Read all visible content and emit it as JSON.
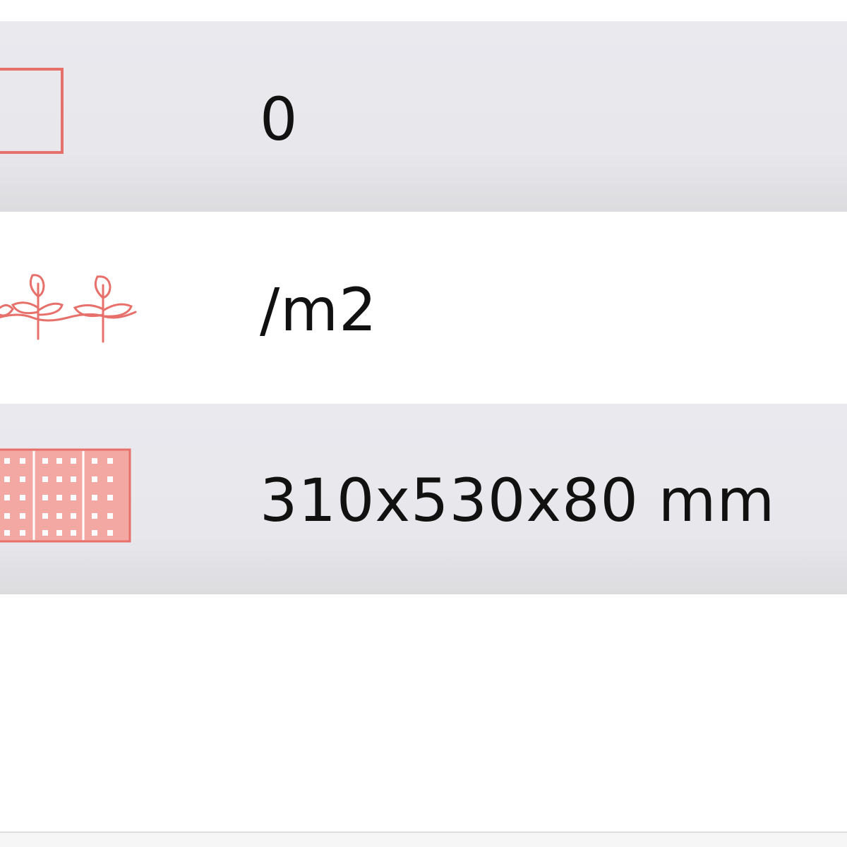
{
  "rows": [
    {
      "icon": "empty-square-icon",
      "value": "0",
      "accent": "#e8706b"
    },
    {
      "icon": "plants-icon",
      "value": "/m2",
      "accent": "#e8706b"
    },
    {
      "icon": "perforated-block-icon",
      "value": "310x530x80 mm",
      "accent": "#e8706b"
    }
  ]
}
